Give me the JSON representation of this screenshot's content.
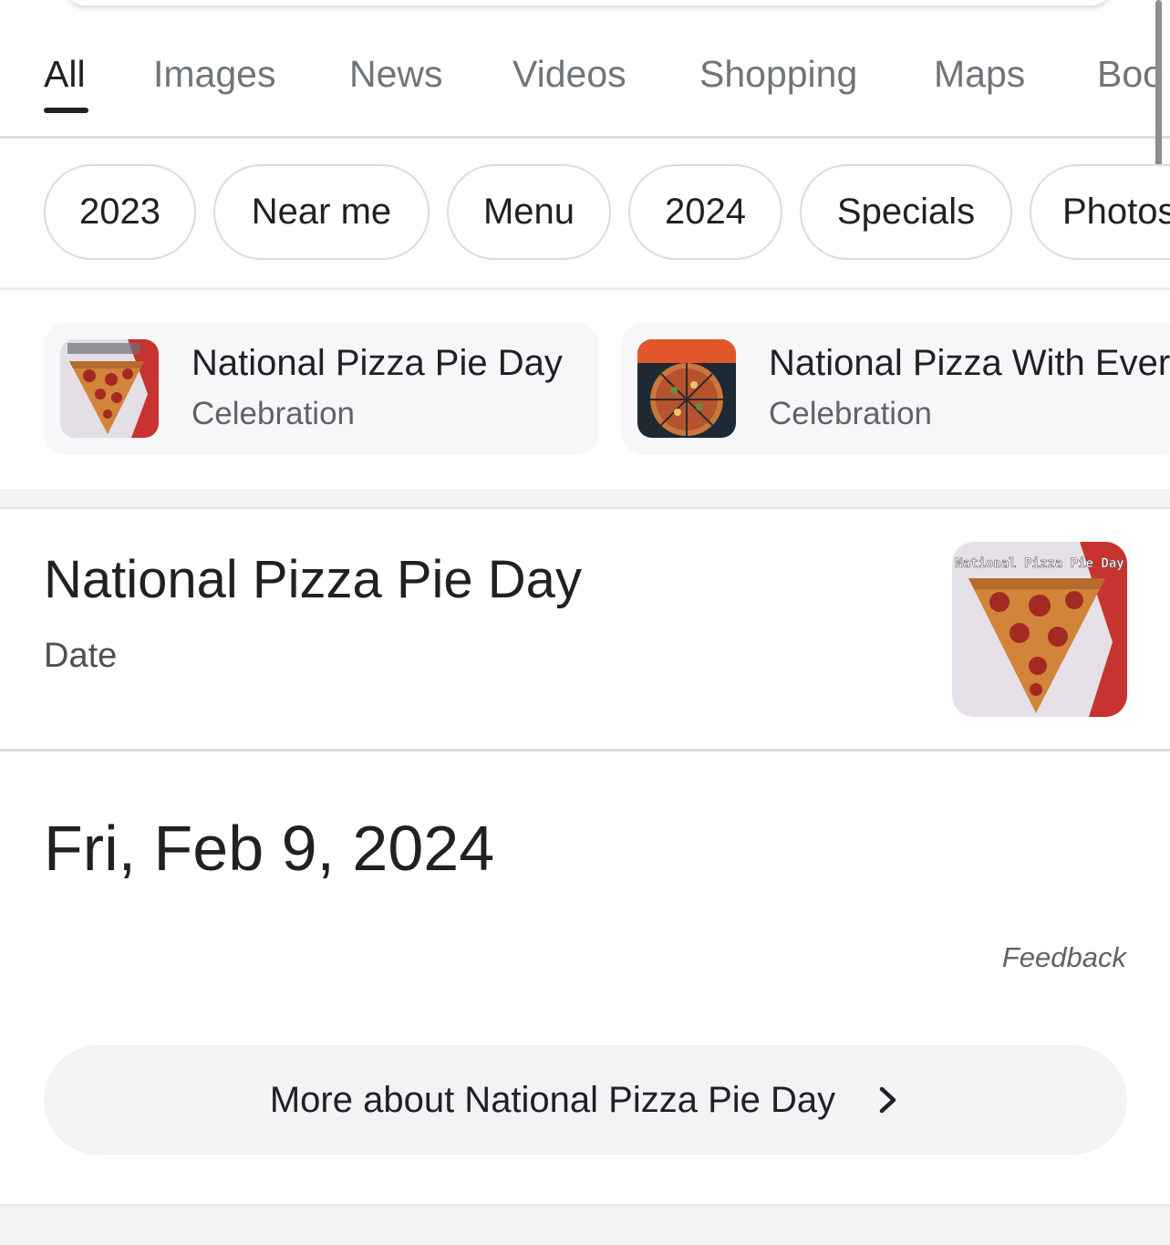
{
  "tabs": [
    {
      "label": "All",
      "active": true
    },
    {
      "label": "Images"
    },
    {
      "label": "News"
    },
    {
      "label": "Videos"
    },
    {
      "label": "Shopping"
    },
    {
      "label": "Maps"
    },
    {
      "label": "Boo"
    }
  ],
  "chips": [
    "2023",
    "Near me",
    "Menu",
    "2024",
    "Specials",
    "Photos"
  ],
  "related": [
    {
      "title": "National Pizza Pie Day",
      "subtitle": "Celebration"
    },
    {
      "title": "National Pizza With Every",
      "subtitle": "Celebration"
    }
  ],
  "answer": {
    "title": "National Pizza Pie Day",
    "subtitle": "Date",
    "thumb_caption": "National Pizza Pie Day",
    "value": "Fri, Feb 9, 2024",
    "feedback": "Feedback",
    "more_label": "More about National Pizza Pie Day"
  },
  "colors": {
    "text": "#202124",
    "muted": "#70757a",
    "pill_bg": "#f1f3f4",
    "border": "#dadce0"
  }
}
